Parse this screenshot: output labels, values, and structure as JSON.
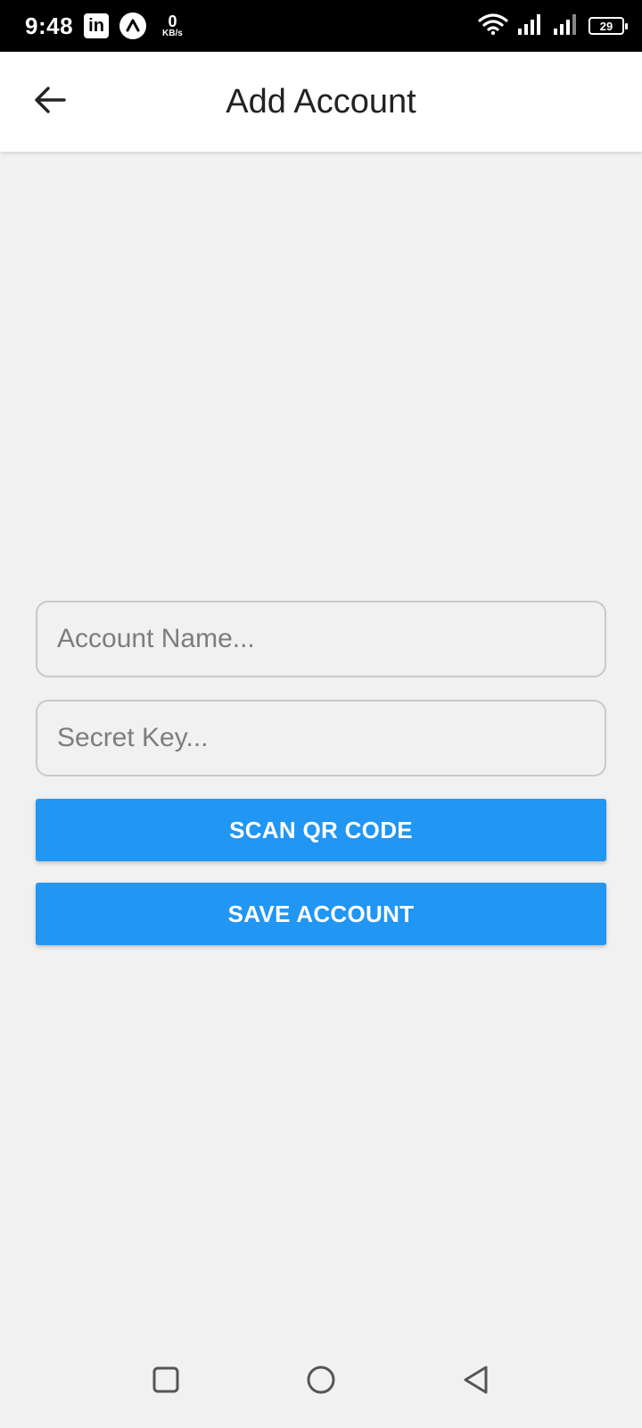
{
  "status_bar": {
    "time": "9:48",
    "linkedin_label": "in",
    "data_rate_value": "0",
    "data_rate_unit": "KB/s",
    "battery_level": "29"
  },
  "app_bar": {
    "title": "Add Account",
    "back_icon": "arrow-left-icon"
  },
  "form": {
    "account_name": {
      "value": "",
      "placeholder": "Account Name..."
    },
    "secret_key": {
      "value": "",
      "placeholder": "Secret Key..."
    },
    "scan_button_label": "SCAN QR CODE",
    "save_button_label": "SAVE ACCOUNT"
  },
  "colors": {
    "accent": "#2196f3",
    "background": "#f1f1f1",
    "app_bar": "#ffffff",
    "status_bar": "#000000"
  },
  "nav_bar": {
    "icons": [
      "recents-square-icon",
      "home-circle-icon",
      "back-triangle-icon"
    ]
  }
}
